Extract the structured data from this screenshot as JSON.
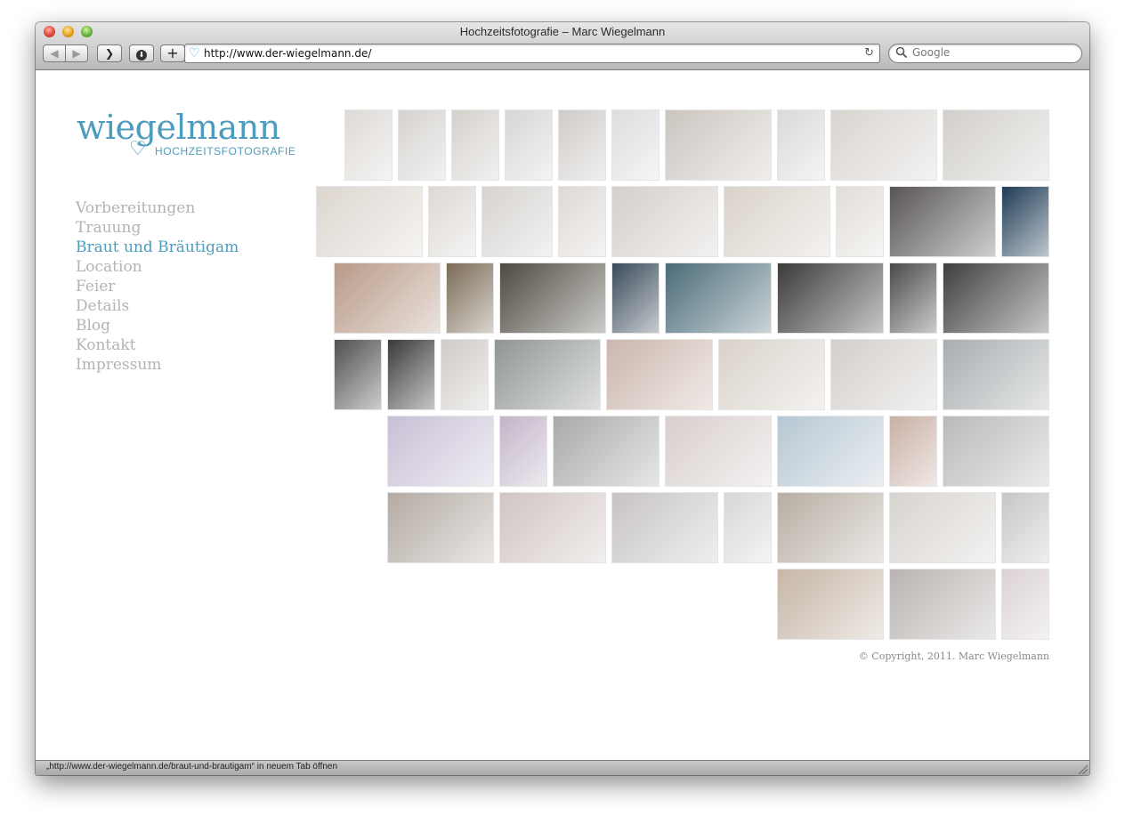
{
  "window": {
    "title": "Hochzeitsfotografie – Marc Wiegelmann"
  },
  "toolbar": {
    "back_icon": "◀",
    "forward_icon": "▶",
    "topsites_icon": "❯",
    "download_icon": "⬇",
    "add_icon": "+",
    "url": "http://www.der-wiegelmann.de/",
    "reload_icon": "↻",
    "search_placeholder": "Google"
  },
  "logo": {
    "word": "wiegelmann",
    "sub": "HOCHZEITSFOTOGRAFIE",
    "heart": "♡"
  },
  "nav": {
    "items": [
      "Vorbereitungen",
      "Trauung",
      "Braut und Bräutigam",
      "Location",
      "Feier",
      "Details",
      "Blog",
      "Kontakt",
      "Impressum"
    ],
    "active_index": 2
  },
  "colors": {
    "accent": "#4d9cbd",
    "nav_inactive": "#b3b3b3"
  },
  "footer": {
    "copyright": "© Copyright, 2011. Marc Wiegelmann"
  },
  "status": {
    "text": "„http://www.der-wiegelmann.de/braut-und-brautigam“ in neuem Tab öffnen"
  }
}
